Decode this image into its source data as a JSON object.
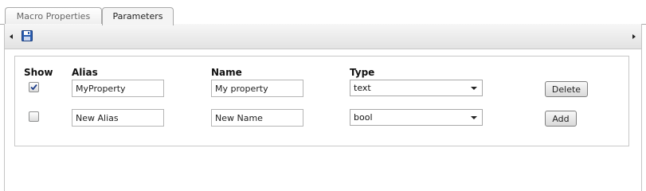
{
  "tabs": [
    {
      "label": "Macro Properties",
      "active": false
    },
    {
      "label": "Parameters",
      "active": true
    }
  ],
  "toolbar": {
    "icons": [
      "scroll-left-icon",
      "save-icon",
      "scroll-right-icon"
    ]
  },
  "table": {
    "headers": {
      "show": "Show",
      "alias": "Alias",
      "name": "Name",
      "type": "Type"
    },
    "rows": [
      {
        "show": true,
        "alias": "MyProperty",
        "name": "My property",
        "type": "text",
        "action": "Delete"
      },
      {
        "show": false,
        "alias": "New Alias",
        "name": "New Name",
        "type": "bool",
        "action": "Add"
      }
    ]
  },
  "colors": {
    "border": "#a9a9a9",
    "toolbar_bg": "#e6e6e6",
    "save_icon": "#2a5db0"
  }
}
